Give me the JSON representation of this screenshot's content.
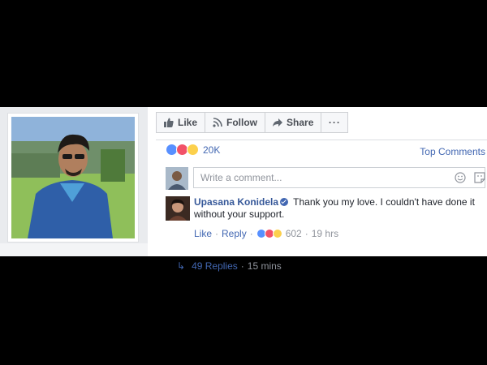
{
  "actions": {
    "like_label": "Like",
    "follow_label": "Follow",
    "share_label": "Share",
    "more_label": "···"
  },
  "reactions": {
    "count": "20K",
    "icons": [
      "like-icon",
      "love-icon",
      "wow-icon"
    ],
    "colors": {
      "like": "#5890ff",
      "love": "#f25268",
      "wow": "#fcd04c"
    }
  },
  "sort": {
    "label": "Top Comments"
  },
  "composer": {
    "placeholder": "Write a comment..."
  },
  "comment": {
    "author": "Upasana Konidela",
    "text": "Thank you my love. I couldn't have done it without your support.",
    "like_label": "Like",
    "reply_label": "Reply",
    "sep": "·",
    "reaction_count": "602",
    "time": "19 hrs"
  },
  "replies": {
    "label": "49 Replies",
    "sep": "·",
    "time": "15 mins"
  },
  "theme": {
    "link": "#4267b2",
    "author": "#365899",
    "muted": "#90949c"
  }
}
